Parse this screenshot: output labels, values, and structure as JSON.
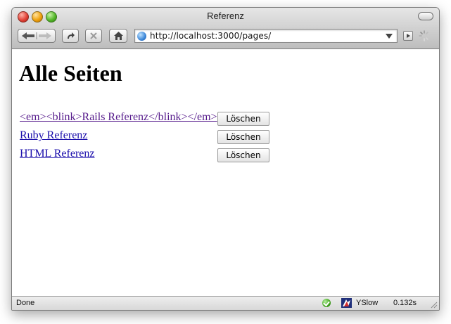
{
  "window": {
    "title": "Referenz"
  },
  "toolbar": {
    "url": "http://localhost:3000/pages/"
  },
  "page": {
    "heading": "Alle Seiten",
    "rows": [
      {
        "link": "<em><blink>Rails Referenz</blink></em>",
        "button": "Löschen",
        "visited": true
      },
      {
        "link": "Ruby Referenz",
        "button": "Löschen",
        "visited": false
      },
      {
        "link": "HTML Referenz",
        "button": "Löschen",
        "visited": false
      }
    ]
  },
  "status": {
    "text": "Done",
    "yslow_label": "YSlow",
    "timing": "0.132s"
  },
  "icons": {
    "back": "back-arrow-icon",
    "forward": "forward-arrow-icon",
    "reload": "reload-icon",
    "stop": "stop-icon",
    "home": "home-icon",
    "site": "globe-icon",
    "go": "go-arrow-icon",
    "loading": "spinner-icon",
    "ok": "check-circle-icon",
    "yslow": "yslow-icon"
  }
}
